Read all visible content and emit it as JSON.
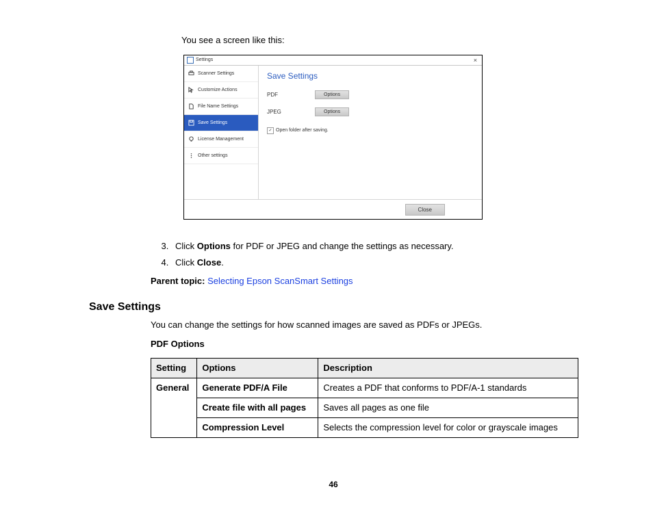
{
  "intro": "You see a screen like this:",
  "dialog": {
    "title": "Settings",
    "sidebar": [
      "Scanner Settings",
      "Customize Actions",
      "File Name Settings",
      "Save Settings",
      "License Management",
      "Other settings"
    ],
    "pane_title": "Save Settings",
    "rows": [
      {
        "label": "PDF",
        "button": "Options"
      },
      {
        "label": "JPEG",
        "button": "Options"
      }
    ],
    "checkbox": "Open folder after saving.",
    "close": "Close"
  },
  "steps": {
    "s3_a": "Click ",
    "s3_b": "Options",
    "s3_c": " for PDF or JPEG and change the settings as necessary.",
    "s4_a": "Click ",
    "s4_b": "Close",
    "s4_c": "."
  },
  "parent_label": "Parent topic: ",
  "parent_link": "Selecting Epson ScanSmart Settings",
  "heading": "Save Settings",
  "section_intro": "You can change the settings for how scanned images are saved as PDFs or JPEGs.",
  "subheading": "PDF Options",
  "table": {
    "headers": [
      "Setting",
      "Options",
      "Description"
    ],
    "setting": "General",
    "rows": [
      {
        "opt": "Generate PDF/A File",
        "desc": "Creates a PDF that conforms to PDF/A-1 standards"
      },
      {
        "opt": "Create file with all pages",
        "desc": "Saves all pages as one file"
      },
      {
        "opt": "Compression Level",
        "desc": "Selects the compression level for color or grayscale images"
      }
    ]
  },
  "page_number": "46"
}
